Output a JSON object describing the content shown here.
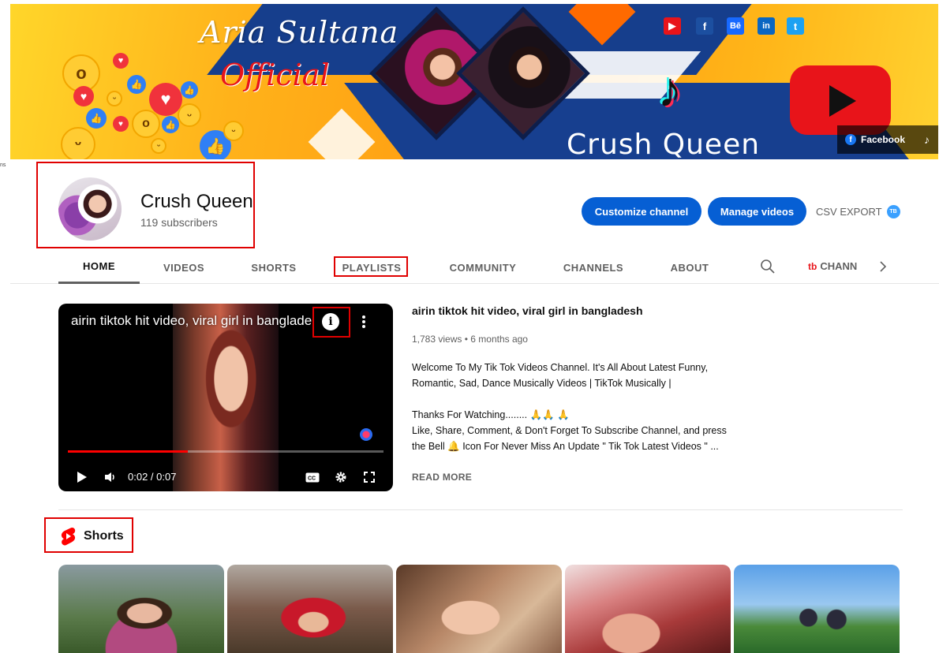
{
  "banner": {
    "title": "Aria Sultana",
    "subtitle": "Official",
    "name": "Crush Queen",
    "social_icons": [
      "youtube-icon",
      "facebook-icon",
      "behance-icon",
      "linkedin-icon",
      "twitter-icon"
    ],
    "links_label": "Facebook",
    "colors": {
      "primary": "#ffb21a",
      "accent": "#163e8c"
    }
  },
  "channel": {
    "name": "Crush Queen",
    "subscribers": "119 subscribers"
  },
  "actions": {
    "customize": "Customize channel",
    "manage": "Manage videos",
    "csv_export": "CSV EXPORT",
    "csv_badge": "TB"
  },
  "tabs": [
    {
      "label": "HOME",
      "active": true
    },
    {
      "label": "VIDEOS"
    },
    {
      "label": "SHORTS"
    },
    {
      "label": "PLAYLISTS"
    },
    {
      "label": "COMMUNITY"
    },
    {
      "label": "CHANNELS"
    },
    {
      "label": "ABOUT"
    }
  ],
  "tab_extra": {
    "logo": "tb",
    "label": "CHANN"
  },
  "featured": {
    "player_title": "airin tiktok hit video, viral girl in banglade",
    "time": "0:02 / 0:07",
    "progress": 0.38,
    "title": "airin tiktok hit video, viral girl in bangladesh",
    "views": "1,783 views",
    "separator": "•",
    "age": "6 months ago",
    "description": "Welcome To My Tik Tok Videos Channel. It's All About Latest Funny, Romantic, Sad, Dance Musically Videos | TikTok Musically |\n\nThanks For Watching........ 🙏🙏 🙏\nLike, Share, Comment, & Don't Forget To Subscribe Channel, and  press the Bell 🔔 Icon For Never Miss An Update \" Tik Tok Latest Videos \" ...",
    "read_more": "READ MORE"
  },
  "shorts": {
    "heading": "Shorts",
    "count": 5
  },
  "misc": {
    "edge_text": "ns"
  }
}
